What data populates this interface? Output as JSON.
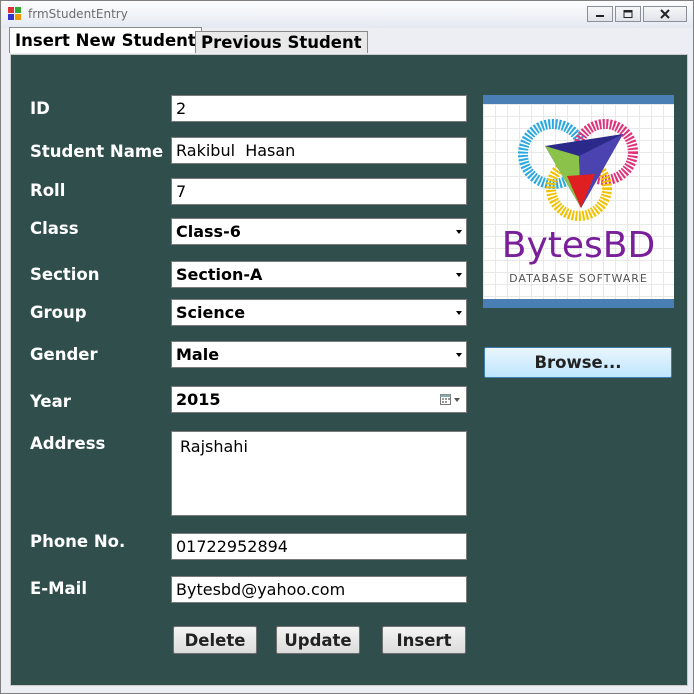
{
  "window": {
    "title": "frmStudentEntry"
  },
  "tabs": [
    {
      "label": "Insert New Student"
    },
    {
      "label": "Previous Student"
    }
  ],
  "form": {
    "id": {
      "label": "ID",
      "value": "2"
    },
    "student_name": {
      "label": "Student Name",
      "value": "Rakibul  Hasan"
    },
    "roll": {
      "label": "Roll",
      "value": "7"
    },
    "class": {
      "label": "Class",
      "value": "Class-6"
    },
    "section": {
      "label": "Section",
      "value": "Section-A"
    },
    "group": {
      "label": "Group",
      "value": "Science"
    },
    "gender": {
      "label": "Gender",
      "value": "Male"
    },
    "year": {
      "label": "Year",
      "value": "2015"
    },
    "address": {
      "label": "Address",
      "value": "Rajshahi"
    },
    "phone": {
      "label": "Phone No.",
      "value": "01722952894"
    },
    "email": {
      "label": "E-Mail",
      "value": "Bytesbd@yahoo.com"
    }
  },
  "buttons": {
    "delete": "Delete",
    "update": "Update",
    "insert": "Insert",
    "browse": "Browse..."
  },
  "logo": {
    "title": "BytesBD",
    "subtitle": "DATABASE SOFTWARE"
  },
  "colors": {
    "panel_bg": "#2f4e4c",
    "logo_text": "#7a1f9a",
    "photo_frame": "#4a7fb6"
  }
}
